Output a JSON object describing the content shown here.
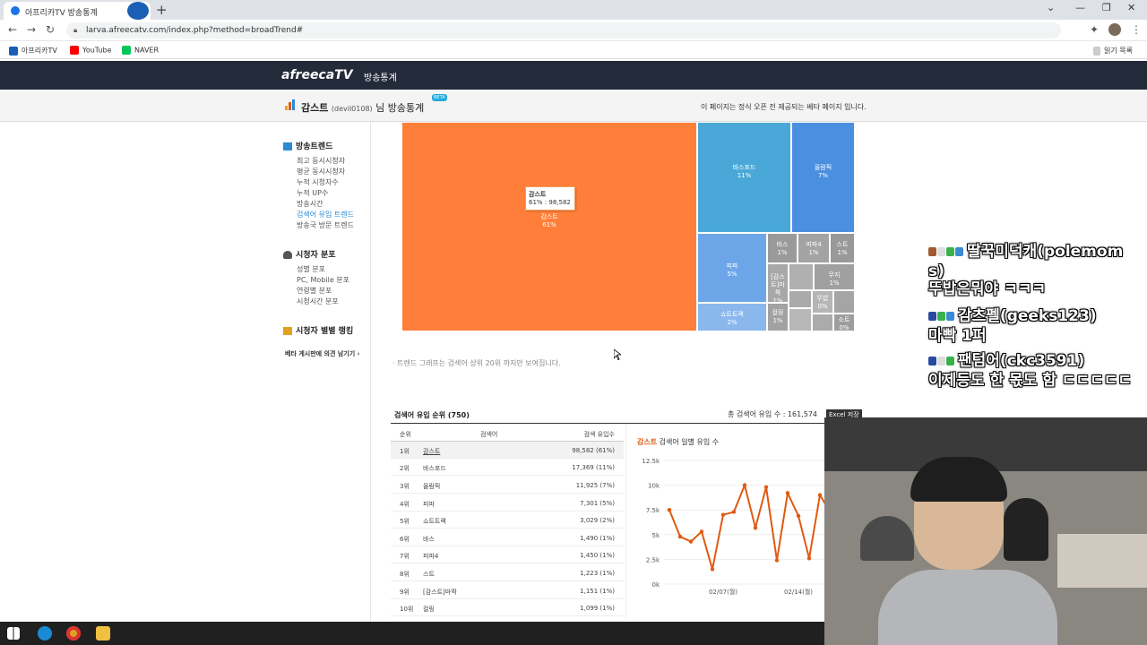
{
  "browser": {
    "tab_title": "아프리카TV 방송통계",
    "url": "larva.afreecatv.com/index.php?method=broadTrend#",
    "bookmarks": [
      "아프리카TV",
      "YouTube",
      "NAVER"
    ],
    "reading_list": "읽기 목록"
  },
  "site": {
    "logo": "afreecaTV",
    "section": "방송통계"
  },
  "subheader": {
    "streamer": "감스트",
    "streamer_id": "(devil0108)",
    "suffix": "님 방송통계",
    "beta": "BETA",
    "note": "이 페이지는 정식 오픈 전 제공되는 베타 페이지 입니다."
  },
  "sidebar": {
    "sections": [
      {
        "title": "방송트렌드",
        "items": [
          "최고 동시시청자",
          "평균 동시시청자",
          "누적 시청자수",
          "누적 UP수",
          "방송시간",
          "검색어 유입 트렌드",
          "방송국 방문 트렌드"
        ]
      },
      {
        "title": "시청자 분포",
        "items": [
          "성별 분포",
          "PC, Mobile 분포",
          "연령별 분포",
          "시청시간 분포"
        ]
      },
      {
        "title": "시청자 별별 랭킹",
        "items": []
      }
    ],
    "active_item": "검색어 유입 트렌드",
    "feedback": "베타 게시판에 의견 남기기 ›"
  },
  "treemap": {
    "cells": [
      {
        "label": "감스트",
        "pct": "61%"
      },
      {
        "label": "바스포드",
        "pct": "11%"
      },
      {
        "label": "올람픽",
        "pct": "7%"
      },
      {
        "label": "피파",
        "pct": "5%"
      },
      {
        "label": "쇼트트랙",
        "pct": "2%"
      },
      {
        "label": "바스",
        "pct": "1%"
      },
      {
        "label": "피파4",
        "pct": "1%"
      },
      {
        "label": "스트",
        "pct": "1%"
      },
      {
        "label": "[감스트]마짝",
        "pct": "1%"
      },
      {
        "label": "무지",
        "pct": "1%"
      },
      {
        "label": "뚜밥",
        "pct": "0%"
      },
      {
        "label": "컬링",
        "pct": "1%"
      },
      {
        "label": "소트",
        "pct": "0%"
      }
    ],
    "tooltip_title": "감스트",
    "tooltip_value": "61% : 98,582",
    "note": "· 트렌드 그래프는 검색어 상위 20위 까지만 보여집니다."
  },
  "ranking": {
    "title": "검색어 유입 순위 (750)",
    "total_label": "총 검색어 유입 수 : 161,574",
    "excel": "Excel 저장",
    "headers": [
      "순위",
      "검색어",
      "검색 유입수"
    ],
    "rows": [
      [
        "1위",
        "감스트",
        "98,582 (61%)"
      ],
      [
        "2위",
        "바스포드",
        "17,369 (11%)"
      ],
      [
        "3위",
        "올람픽",
        "11,925 (7%)"
      ],
      [
        "4위",
        "피파",
        "7,301 (5%)"
      ],
      [
        "5위",
        "쇼트트랙",
        "3,029 (2%)"
      ],
      [
        "6위",
        "바스",
        "1,490 (1%)"
      ],
      [
        "7위",
        "피파4",
        "1,450 (1%)"
      ],
      [
        "8위",
        "스트",
        "1,223 (1%)"
      ],
      [
        "9위",
        "[감스트]마짝",
        "1,151 (1%)"
      ],
      [
        "10위",
        "컬링",
        "1,099 (1%)"
      ]
    ]
  },
  "line_chart": {
    "title_name": "감스트",
    "title_rest": " 검색어 일별 유입 수",
    "y_ticks": [
      "12.5k",
      "10k",
      "7.5k",
      "5k",
      "2.5k",
      "0k"
    ],
    "x_ticks": [
      "02/07(월)",
      "02/14(월)"
    ],
    "color": "#e05a12"
  },
  "chart_data": {
    "type": "line",
    "title": "감스트 검색어 일별 유입 수",
    "ylim": [
      0,
      12500
    ],
    "series": [
      {
        "name": "감스트",
        "values": [
          7500,
          4800,
          4300,
          5300,
          1500,
          7000,
          7300,
          10000,
          5700,
          9800,
          2400,
          9200,
          6900,
          2600,
          9000,
          7200
        ]
      }
    ]
  },
  "overlay_chat": [
    "딸꾹미덕캐(polemom",
    "s)",
    "뚜밥은뭐야 ㅋㅋㅋ",
    "감츠펠(geeks123)",
    "마빡 1퍼",
    "팬텀어(ckc3591)",
    "이제등도 한 몫도 함 ㄷㄷㄷㄷㄷ"
  ]
}
